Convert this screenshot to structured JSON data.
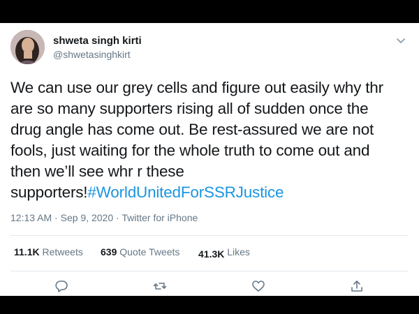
{
  "tweet": {
    "author_name": "shweta singh kirti",
    "author_handle": "@shwetasinghkirt",
    "text_lines": [
      "We can use our grey cells and figure out easily why thr",
      "are so many supporters rising all of sudden once the",
      "drug angle has come out. Be rest-assured we are not",
      "fools, just waiting for the whole truth to come out and",
      "then we’ll see whr r these"
    ],
    "last_line_text": "supporters!",
    "hashtag": "#WorldUnitedForSSRJustice",
    "time": "12:13 AM",
    "date": "Sep 9, 2020",
    "separator": "·",
    "source": "Twitter for iPhone"
  },
  "stats": {
    "retweets_count": "11.1K",
    "retweets_label": "Retweets",
    "quote_count": "639",
    "quote_label": "Quote Tweets",
    "likes_count": "41.3K",
    "likes_label": "Likes"
  },
  "actions": {
    "icons": [
      "reply-icon",
      "retweet-icon",
      "like-icon",
      "share-icon"
    ]
  },
  "colors": {
    "text": "#14171a",
    "secondary": "#657786",
    "link": "#1b95e0",
    "divider": "#e1e8ed"
  }
}
